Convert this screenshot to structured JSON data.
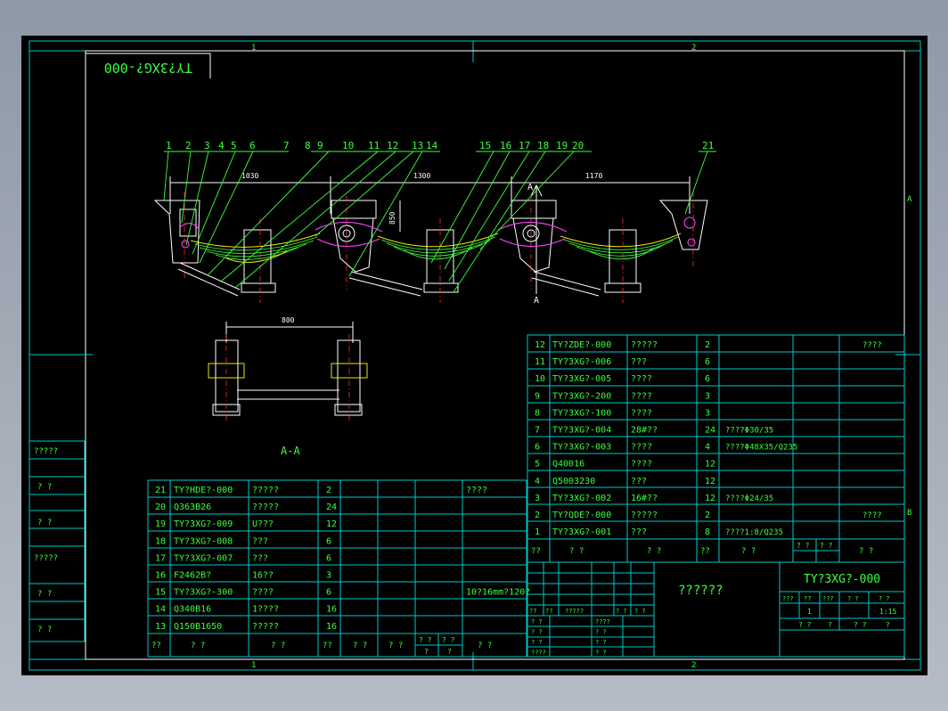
{
  "title_block_label": "TY?3XG?-000",
  "sheet": {
    "top_zone_labels": [
      "1",
      "2"
    ],
    "bottom_zone_labels": [
      "1",
      "2"
    ],
    "side_zone_labels": [
      "A",
      "B"
    ]
  },
  "drawing": {
    "balloons": [
      "1",
      "2",
      "3",
      "4",
      "5",
      "6",
      "7",
      "8",
      "9",
      "10",
      "11",
      "12",
      "13",
      "14",
      "15",
      "16",
      "17",
      "18",
      "19",
      "20",
      "21"
    ],
    "dims": {
      "d1": "1030",
      "d2": "1300",
      "d3": "1170",
      "d4": "850",
      "d5": "800"
    },
    "section_marks": [
      "A",
      "A"
    ],
    "section_view_title": "A-A"
  },
  "left_stamps": [
    "?????",
    "?  ?",
    "?  ?",
    "?????",
    "?  ?",
    "?  ?"
  ],
  "bom_left": {
    "rows": [
      {
        "no": "21",
        "code": "TY?HDE?-000",
        "name": "?????",
        "qty": "2",
        "note": "????"
      },
      {
        "no": "20",
        "code": "Q363B26",
        "name": "?????",
        "qty": "24",
        "note": ""
      },
      {
        "no": "19",
        "code": "TY?3XG?-009",
        "name": "U???",
        "qty": "12",
        "note": ""
      },
      {
        "no": "18",
        "code": "TY?3XG?-008",
        "name": "???",
        "qty": "6",
        "note": ""
      },
      {
        "no": "17",
        "code": "TY?3XG?-007",
        "name": "???",
        "qty": "6",
        "note": ""
      },
      {
        "no": "16",
        "code": "F2462B?",
        "name": "16??",
        "qty": "3",
        "note": ""
      },
      {
        "no": "15",
        "code": "TY?3XG?-300",
        "name": "????",
        "qty": "6",
        "note": "10?16mm?120?"
      },
      {
        "no": "14",
        "code": "Q340B16",
        "name": "1????",
        "qty": "16",
        "note": ""
      },
      {
        "no": "13",
        "code": "Q150B1650",
        "name": "?????",
        "qty": "16",
        "note": ""
      }
    ],
    "header": [
      "??",
      "?  ?",
      "?  ?",
      "??",
      "?  ?",
      "?  ?",
      "?  ?"
    ],
    "header_small": [
      "? ?",
      "? ?",
      "?",
      "?"
    ]
  },
  "bom_right": {
    "rows": [
      {
        "no": "12",
        "code": "TY?ZDE?-000",
        "name": "?????",
        "qty": "2",
        "mat": "",
        "note": "????"
      },
      {
        "no": "11",
        "code": "TY?3XG?-006",
        "name": "???",
        "qty": "6",
        "mat": "",
        "note": ""
      },
      {
        "no": "10",
        "code": "TY?3XG?-005",
        "name": "????",
        "qty": "6",
        "mat": "",
        "note": ""
      },
      {
        "no": "9",
        "code": "TY?3XG?-200",
        "name": "????",
        "qty": "3",
        "mat": "",
        "note": ""
      },
      {
        "no": "8",
        "code": "TY?3XG?-100",
        "name": "????",
        "qty": "3",
        "mat": "",
        "note": ""
      },
      {
        "no": "7",
        "code": "TY?3XG?-004",
        "name": "28#??",
        "qty": "24",
        "mat": "????Φ30/35",
        "note": ""
      },
      {
        "no": "6",
        "code": "TY?3XG?-003",
        "name": "????",
        "qty": "4",
        "mat": "????Φ48X35/Q235",
        "note": ""
      },
      {
        "no": "5",
        "code": "Q40016",
        "name": "????",
        "qty": "12",
        "mat": "",
        "note": ""
      },
      {
        "no": "4",
        "code": "Q5003230",
        "name": "???",
        "qty": "12",
        "mat": "",
        "note": ""
      },
      {
        "no": "3",
        "code": "TY?3XG?-002",
        "name": "16#??",
        "qty": "12",
        "mat": "????Φ24/35",
        "note": ""
      },
      {
        "no": "2",
        "code": "TY?QDE?-000",
        "name": "?????",
        "qty": "2",
        "mat": "",
        "note": "????"
      },
      {
        "no": "1",
        "code": "TY?3XG?-001",
        "name": "???",
        "qty": "8",
        "mat": "????1:8/Q235",
        "note": ""
      }
    ],
    "header": [
      "??",
      "?  ?",
      "?  ?",
      "??",
      "?  ?",
      "? ?",
      "? ?",
      "?  ?"
    ]
  },
  "title_block": {
    "drawing_name": "??????",
    "drawing_code": "TY?3XG?-000",
    "stage_headers": [
      "???",
      "??",
      "???",
      "? ?",
      "? ?"
    ],
    "stage_values": [
      "",
      "1",
      "",
      "",
      "1:15"
    ],
    "sheet_cells": [
      "?  ?",
      "?",
      "?  ?",
      "?"
    ],
    "sign_header": [
      "??",
      "??",
      "?????",
      "? ?",
      "? ?"
    ],
    "sign_rows": [
      {
        "a": "? ?",
        "b": "????"
      },
      {
        "a": "? ?",
        "b": "? ?"
      },
      {
        "a": "? ?",
        "b": "? ?"
      },
      {
        "a": "????",
        "b": "? ?"
      }
    ]
  }
}
